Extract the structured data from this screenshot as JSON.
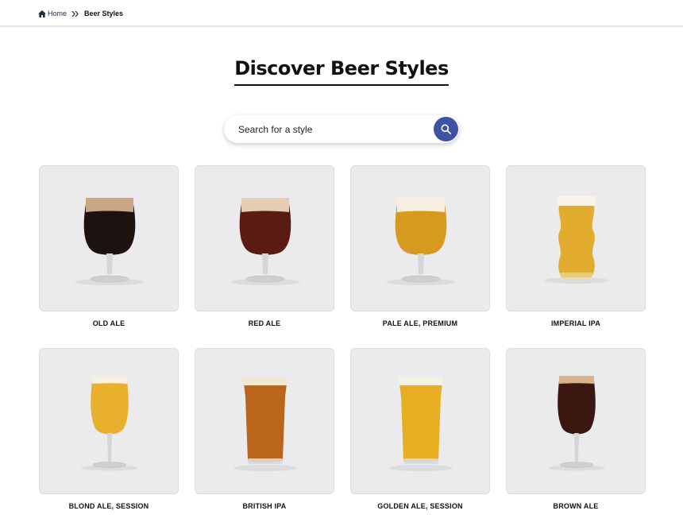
{
  "breadcrumb": {
    "home": "Home",
    "current": "Beer Styles"
  },
  "page": {
    "title": "Discover Beer Styles"
  },
  "search": {
    "placeholder": "Search for a style"
  },
  "colors": {
    "accent": "#3e53a3",
    "card_bg": "#ebebed"
  },
  "styles": [
    {
      "name": "OLD ALE",
      "glass": "snifter",
      "beer": "#1c1210",
      "foam": "#c9a684"
    },
    {
      "name": "RED ALE",
      "glass": "snifter",
      "beer": "#5a1b12",
      "foam": "#e4cdb2"
    },
    {
      "name": "PALE ALE, PREMIUM",
      "glass": "snifter",
      "beer": "#d8991f",
      "foam": "#f7f0e2"
    },
    {
      "name": "IMPERIAL IPA",
      "glass": "tumbler",
      "beer": "#e2ad2e",
      "foam": "#f8f4ea"
    },
    {
      "name": "BLOND ALE, SESSION",
      "glass": "tulip",
      "beer": "#e8b02c",
      "foam": "#f7f1e3"
    },
    {
      "name": "BRITISH IPA",
      "glass": "nonic",
      "beer": "#b9651a",
      "foam": "#f1e6d2"
    },
    {
      "name": "GOLDEN ALE, SESSION",
      "glass": "nonic",
      "beer": "#e7ae21",
      "foam": "#f7f1e3"
    },
    {
      "name": "BROWN ALE",
      "glass": "tulip",
      "beer": "#3a1710",
      "foam": "#d8b28a"
    }
  ]
}
